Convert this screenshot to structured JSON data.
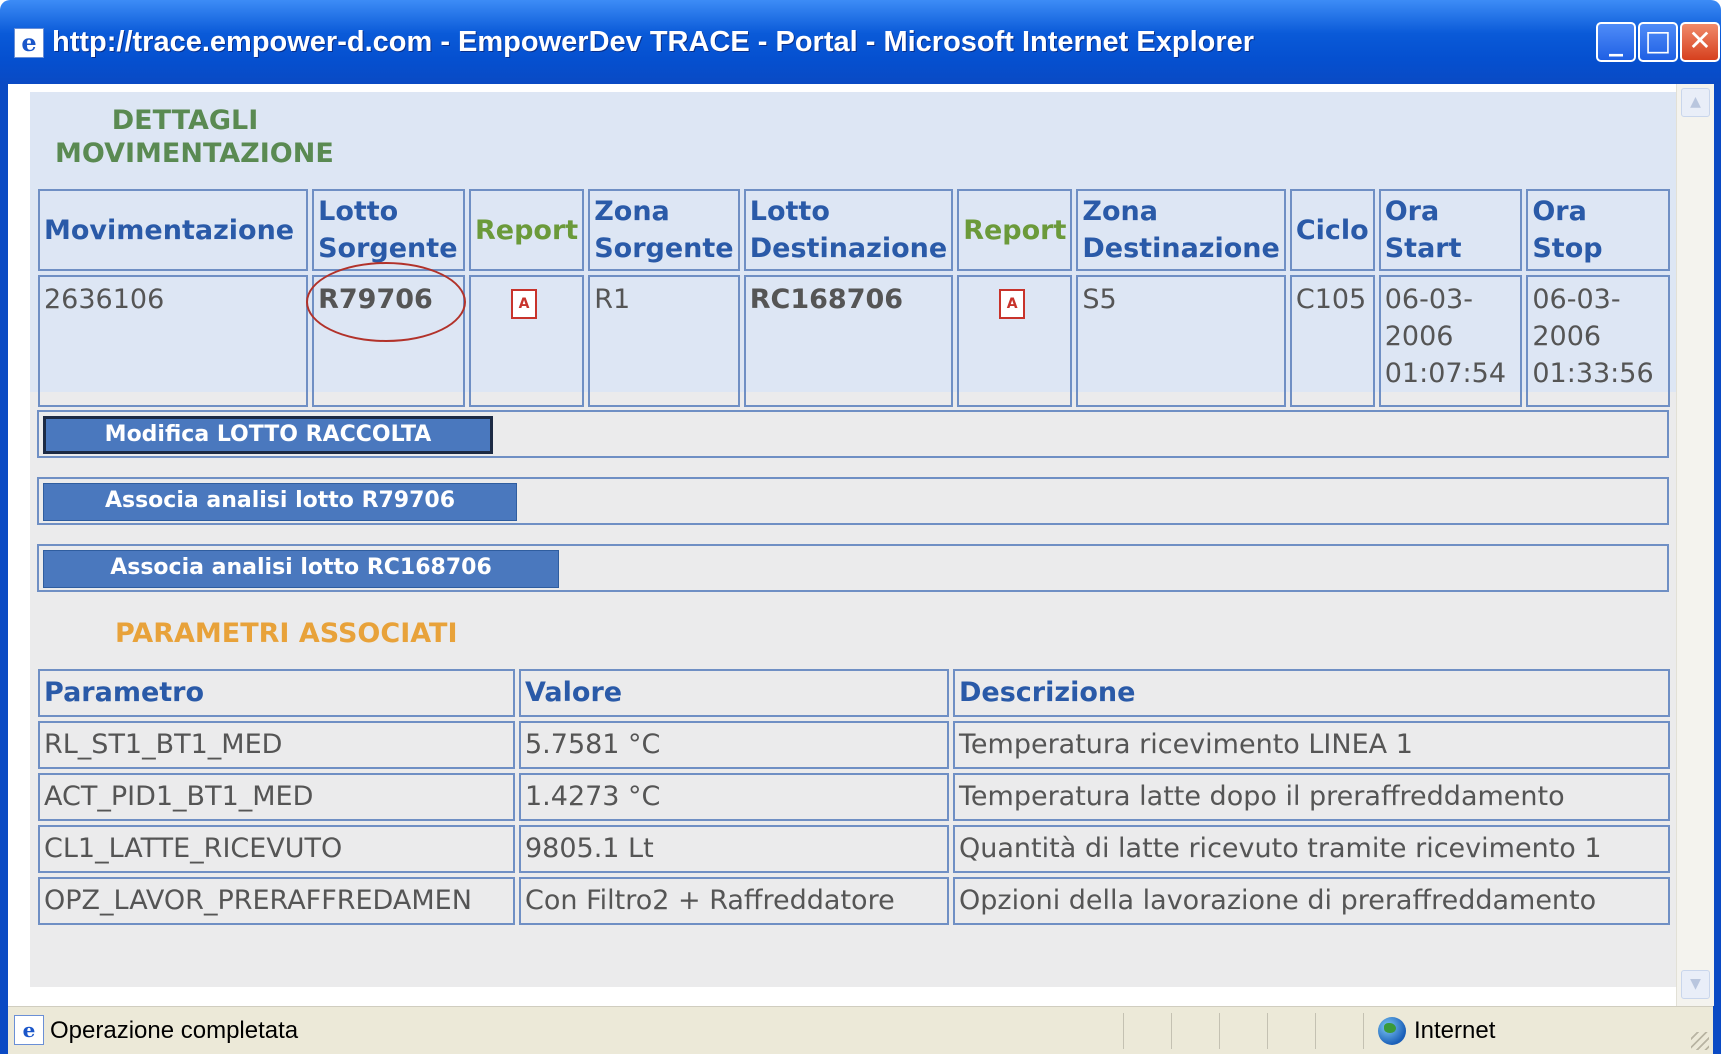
{
  "window": {
    "title": "http://trace.empower-d.com - EmpowerDev TRACE - Portal - Microsoft Internet Explorer",
    "minimize_glyph": "_",
    "maximize_glyph": "□",
    "close_glyph": "✕"
  },
  "headings": {
    "movimentazione": "DETTAGLI MOVIMENTAZIONE",
    "parametri": "PARAMETRI ASSOCIATI"
  },
  "movimentazione_table": {
    "headers": [
      "Movimentazione",
      "Lotto Sorgente",
      "Report",
      "Zona Sorgente",
      "Lotto Destinazione",
      "Report",
      "Zona Destinazione",
      "Ciclo",
      "Ora Start",
      "Ora Stop"
    ],
    "row": {
      "movimentazione": "2636106",
      "lotto_sorgente": "R79706",
      "zona_sorgente": "R1",
      "lotto_destinazione": "RC168706",
      "zona_destinazione": "S5",
      "ciclo": "C105",
      "ora_start": "06-03-2006 01:07:54",
      "ora_stop": "06-03-2006 01:33:56"
    }
  },
  "buttons": {
    "modifica": "Modifica LOTTO RACCOLTA",
    "associa_sorgente": "Associa analisi lotto R79706",
    "associa_destinazione": "Associa analisi lotto RC168706"
  },
  "parametri_table": {
    "headers": [
      "Parametro",
      "Valore",
      "Descrizione"
    ],
    "rows": [
      [
        "RL_ST1_BT1_MED",
        "5.7581 °C",
        "Temperatura ricevimento LINEA 1"
      ],
      [
        "ACT_PID1_BT1_MED",
        "1.4273 °C",
        "Temperatura latte dopo il preraffreddamento"
      ],
      [
        "CL1_LATTE_RICEVUTO",
        "9805.1 Lt",
        "Quantità di latte ricevuto tramite ricevimento 1"
      ],
      [
        "OPZ_LAVOR_PRERAFFREDAMEN",
        "Con Filtro2 + Raffreddatore",
        "Opzioni della lavorazione di preraffreddamento"
      ]
    ]
  },
  "statusbar": {
    "status": "Operazione completata",
    "zone": "Internet"
  },
  "icons": {
    "pdf": "pdf-report-icon",
    "globe": "internet-zone-icon",
    "ie": "ie-page-icon"
  },
  "colors": {
    "titlebar": "#0a5ad8",
    "header_text": "#2a5aa8",
    "report_header": "#6b9a3a",
    "heading_green": "#5a8a52",
    "heading_orange": "#e8a23a",
    "button_blue": "#4a78be",
    "annotation_circle": "#b2322a"
  }
}
